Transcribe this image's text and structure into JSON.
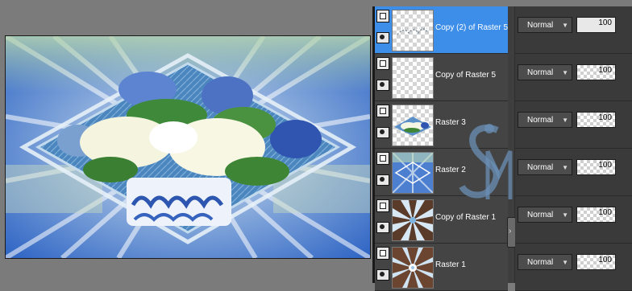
{
  "layers": [
    {
      "name": "Copy (2) of Raster 5",
      "blend_mode": "Normal",
      "opacity": "100",
      "selected": true
    },
    {
      "name": "Copy of Raster 5",
      "blend_mode": "Normal",
      "opacity": "100",
      "selected": false
    },
    {
      "name": "Raster 3",
      "blend_mode": "Normal",
      "opacity": "100",
      "selected": false
    },
    {
      "name": "Raster 2",
      "blend_mode": "Normal",
      "opacity": "100",
      "selected": false
    },
    {
      "name": "Copy of Raster 1",
      "blend_mode": "Normal",
      "opacity": "100",
      "selected": false
    },
    {
      "name": "Raster 1",
      "blend_mode": "Normal",
      "opacity": "100",
      "selected": false
    }
  ],
  "icons": {
    "visibility": "eye-icon",
    "layer_type": "raster-layer-icon",
    "dropdown": "chevron-down-icon",
    "collapse": "chevron-right-icon"
  },
  "colors": {
    "selected_row": "#3d8ee8",
    "panel_bg": "#444444",
    "workspace_bg": "#7b7b7b"
  }
}
